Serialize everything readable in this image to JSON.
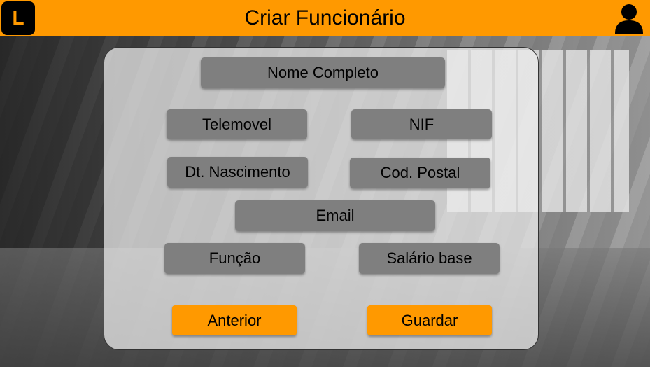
{
  "header": {
    "logo_letter": "L",
    "title": "Criar Funcionário",
    "accent_color": "#ff9900"
  },
  "form": {
    "nome_completo": "Nome Completo",
    "telemovel": "Telemovel",
    "nif": "NIF",
    "dt_nascimento": "Dt. Nascimento",
    "cod_postal": "Cod. Postal",
    "email": "Email",
    "funcao": "Função",
    "salario_base": "Salário base"
  },
  "actions": {
    "previous_label": "Anterior",
    "save_label": "Guardar"
  }
}
